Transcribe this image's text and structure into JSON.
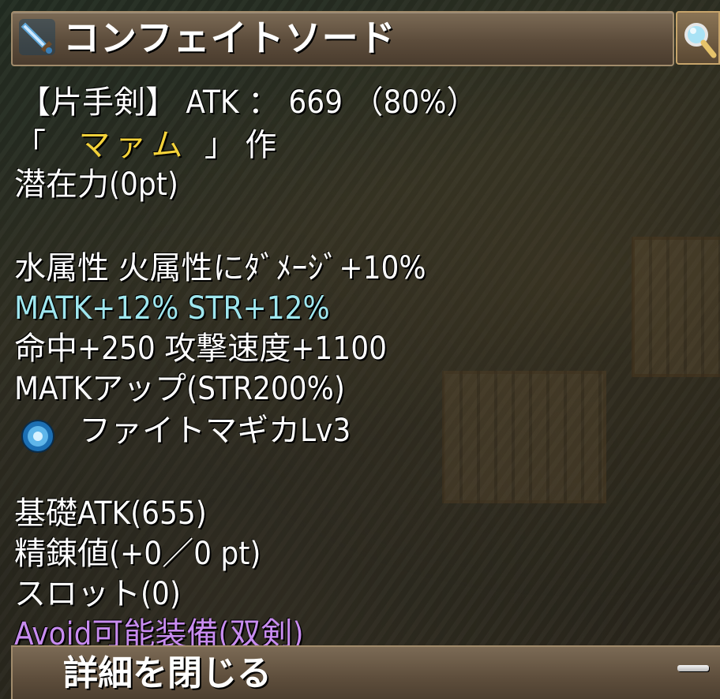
{
  "title": {
    "text": "コンフェイトソード",
    "icon": "sword-icon"
  },
  "search_button": {
    "icon": "magnifier-icon"
  },
  "lines": {
    "type_atk": "【片手剣】 ATK ： 669 （80%）",
    "crafter_open": "「",
    "crafter_name": "マァム",
    "crafter_close": "」 作",
    "potential": "潜在力(0pt)",
    "element": "水属性 火属性にﾀﾞﾒｰｼﾞ+10%",
    "matk_str": "MATK+12% STR+12%",
    "hit_aspd": "命中+250 攻撃速度+1100",
    "matk_up": "MATKアップ(STR200%)",
    "skill": "ファイトマギカLv3",
    "base_atk": "基礎ATK(655)",
    "refine": "精錬値(+0／0 pt)",
    "slot": "スロット(0)",
    "avoid": "Avoid可能装備(双剣)"
  },
  "skill_icon": "blue-orb-icon",
  "footer": {
    "label": "詳細を閉じる",
    "icon": "minus-icon"
  },
  "colors": {
    "text": "#ffffff",
    "stat_highlight": "#9fe7ef",
    "crafter": "#f3d23a",
    "avoid": "#c88cf0",
    "bar": "#6b5a46"
  }
}
